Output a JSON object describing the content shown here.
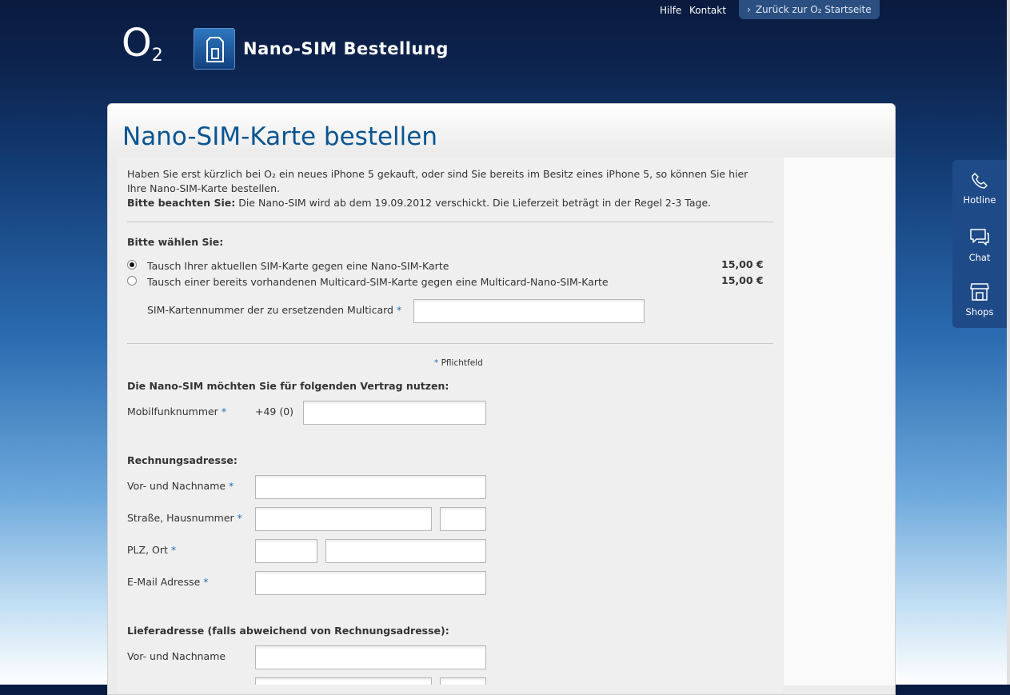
{
  "topnav": {
    "help": "Hilfe",
    "contact": "Kontakt",
    "back": "Zurück zur O₂ Startseite"
  },
  "header": {
    "logo": "O",
    "logo_sub": "2",
    "app_title": "Nano-SIM Bestellung",
    "app_icon": "sim-card-icon"
  },
  "page": {
    "title": "Nano-SIM-Karte bestellen"
  },
  "intro": {
    "line1": "Haben Sie erst kürzlich bei O₂ ein neues iPhone 5 gekauft, oder sind Sie bereits im Besitz eines iPhone 5, so können Sie hier",
    "line2": "Ihre Nano-SIM-Karte bestellen.",
    "notice_label": "Bitte beachten Sie:",
    "notice_text": " Die Nano-SIM wird ab dem 19.09.2012 verschickt. Die Lieferzeit beträgt in der Regel 2-3 Tage."
  },
  "choice": {
    "heading": "Bitte wählen Sie:",
    "options": [
      {
        "label": "Tausch Ihrer aktuellen SIM-Karte gegen eine Nano-SIM-Karte",
        "price": "15,00 €",
        "selected": true
      },
      {
        "label": "Tausch einer bereits vorhandenen Multicard-SIM-Karte gegen eine Multicard-Nano-SIM-Karte",
        "price": "15,00 €",
        "selected": false
      }
    ],
    "multicard_label": "SIM-Kartennummer der zu ersetzenden Multicard",
    "multicard_value": ""
  },
  "required_note": "Pflichtfeld",
  "required_marker": "*",
  "contract": {
    "heading": "Die Nano-SIM möchten Sie für folgenden Vertrag nutzen:",
    "mobile_label": "Mobilfunknummer",
    "prefix": "+49 (0)",
    "mobile_value": ""
  },
  "billing": {
    "heading": "Rechnungsadresse:",
    "name_label": "Vor- und Nachname",
    "street_label": "Straße, Hausnummer",
    "zip_label": "PLZ, Ort",
    "email_label": "E-Mail Adresse"
  },
  "delivery": {
    "heading": "Lieferadresse (falls abweichend von Rechnungsadresse):",
    "name_label": "Vor- und Nachname"
  },
  "sidebar": [
    {
      "label": "Hotline",
      "icon": "phone-icon"
    },
    {
      "label": "Chat",
      "icon": "chat-icon"
    },
    {
      "label": "Shops",
      "icon": "shop-icon"
    }
  ],
  "colors": {
    "accent": "#1f6fb7",
    "title": "#0a5590",
    "sidebar": "#1e4a88"
  }
}
